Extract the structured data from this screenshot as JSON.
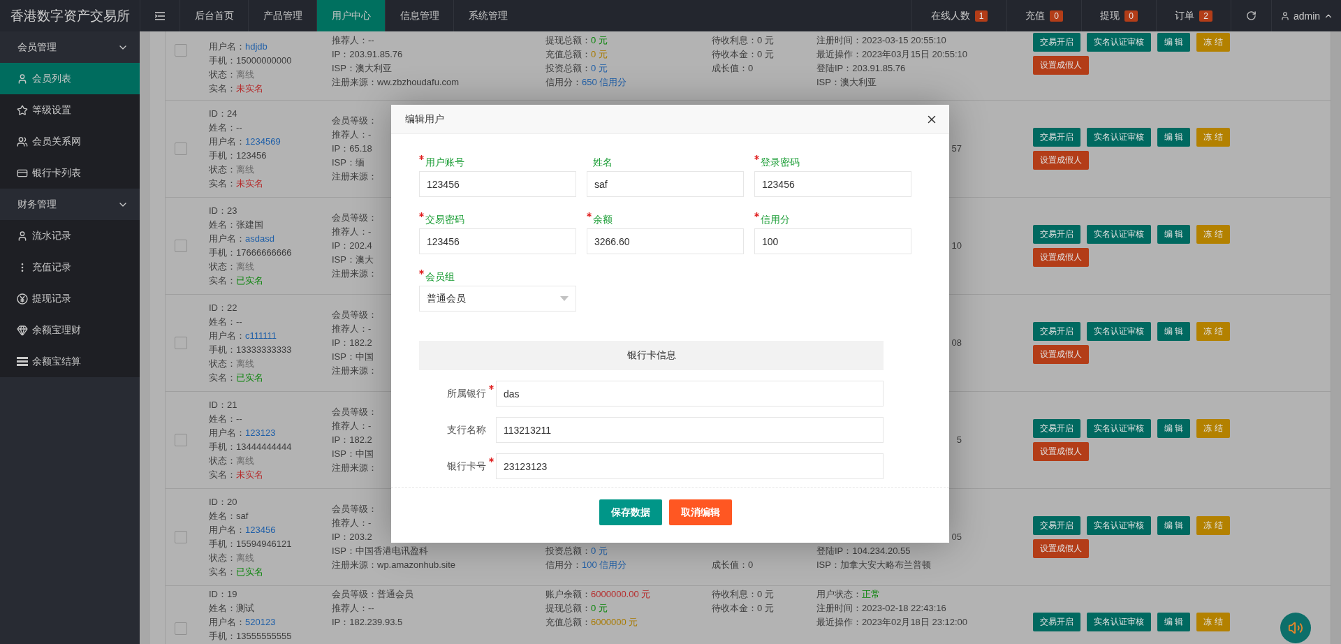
{
  "topbar": {
    "title": "香港数字资产交易所",
    "nav": [
      {
        "label": "后台首页",
        "selected": false
      },
      {
        "label": "产品管理",
        "selected": false
      },
      {
        "label": "用户中心",
        "selected": true
      },
      {
        "label": "信息管理",
        "selected": false
      },
      {
        "label": "系统管理",
        "selected": false
      }
    ],
    "stats": [
      {
        "label": "在线人数",
        "count": "1"
      },
      {
        "label": "充值",
        "count": "0"
      },
      {
        "label": "提现",
        "count": "0"
      },
      {
        "label": "订单",
        "count": "2"
      }
    ],
    "user": "admin"
  },
  "sidebar": {
    "groups": [
      {
        "label": "会员管理",
        "expanded": true,
        "items": [
          {
            "label": "会员列表",
            "selected": true
          },
          {
            "label": "等级设置",
            "selected": false
          },
          {
            "label": "会员关系网",
            "selected": false
          },
          {
            "label": "银行卡列表",
            "selected": false
          }
        ]
      },
      {
        "label": "财务管理",
        "expanded": true,
        "items": [
          {
            "label": "流水记录",
            "selected": false
          },
          {
            "label": "充值记录",
            "selected": false
          },
          {
            "label": "提现记录",
            "selected": false
          },
          {
            "label": "余额宝理财",
            "selected": false
          },
          {
            "label": "余额宝结算",
            "selected": false
          }
        ]
      }
    ]
  },
  "table": {
    "rows": [
      {
        "checked": false,
        "kind": "top",
        "cells": {
          "column_1": [
            {
              "label": "用户名：",
              "value": "hdjdb",
              "kind": "link"
            },
            {
              "label": "手机：",
              "value": "15000000000"
            },
            {
              "label": "状态：",
              "value": "离线",
              "color": "#6a6a6a"
            },
            {
              "label": "实名：",
              "value": "未实名",
              "color": "#b52a2a"
            }
          ],
          "column_2": [
            {
              "text": "推荐人：--"
            },
            {
              "label": "IP：",
              "value": "203.91.85.76"
            },
            {
              "label": "ISP：",
              "value": "澳大利亚"
            },
            {
              "label": "注册来源：",
              "value": "ww.zbzhoudafu.com"
            }
          ],
          "column_3": [
            {
              "label": "提现总额：",
              "value": "0 元",
              "color": "#0a840a"
            },
            {
              "label": "充值总额：",
              "value": "0 元",
              "color": "#a87a00"
            },
            {
              "label": "投资总额：",
              "value": "0 元",
              "color": "#1f5fa8"
            },
            {
              "label": "信用分：",
              "value": "650 信用分",
              "color": "#1f5fa8"
            }
          ],
          "column_4": [
            {
              "label": "待收利息：",
              "value": "0 元"
            },
            {
              "label": "待收本金：",
              "value": "0 元"
            },
            {
              "label": "成长值：",
              "value": "0"
            }
          ],
          "column_5": [
            {
              "label": "注册时间：",
              "value": "2023-03-15 20:55:10"
            },
            {
              "label": "最近操作：",
              "value": "2023年03月15日 20:55:10"
            },
            {
              "label": "登陆IP：",
              "value": "203.91.85.76"
            },
            {
              "label": "ISP：",
              "value": "澳大利亚"
            }
          ]
        },
        "actions": [
          {
            "label": "交易开启",
            "kind": "primary"
          },
          {
            "label": "实名认证审核",
            "kind": "primary"
          },
          {
            "label": "编 辑",
            "kind": "primary"
          },
          {
            "label": "冻 结",
            "kind": "warm"
          },
          {
            "label": "设置成假人",
            "kind": "danger"
          }
        ]
      },
      {
        "checked": false,
        "kind": "middle",
        "cells": {
          "column_1": [
            {
              "label": "ID：",
              "value": "24"
            },
            {
              "text": "姓名：--"
            },
            {
              "label": "用户名：",
              "value": "1234569",
              "kind": "link"
            },
            {
              "label": "手机：",
              "value": "123456"
            },
            {
              "label": "状态：",
              "value": "离线",
              "color": "#6a6a6a"
            },
            {
              "label": "实名：",
              "value": "未实名",
              "color": "#b52a2a"
            }
          ],
          "column_2": [
            {
              "label": "会员等级："
            },
            {
              "text": "推荐人：-"
            },
            {
              "label": "IP：",
              "value": "65.18"
            },
            {
              "label": "ISP：",
              "value": "缅"
            },
            {
              "label": "注册来源："
            }
          ],
          "column_5": [
            {
              "value": "57",
              "kind": "tail"
            }
          ]
        },
        "actions": [
          {
            "label": "交易开启",
            "kind": "primary"
          },
          {
            "label": "实名认证审核",
            "kind": "primary"
          },
          {
            "label": "编 辑",
            "kind": "primary"
          },
          {
            "label": "冻 结",
            "kind": "warm"
          },
          {
            "label": "设置成假人",
            "kind": "danger"
          }
        ]
      },
      {
        "checked": false,
        "kind": "middle",
        "cells": {
          "column_1": [
            {
              "label": "ID：",
              "value": "23"
            },
            {
              "label": "姓名：",
              "value": "张建国"
            },
            {
              "label": "用户名：",
              "value": "asdasd",
              "kind": "link"
            },
            {
              "label": "手机：",
              "value": "17666666666"
            },
            {
              "label": "状态：",
              "value": "离线",
              "color": "#6a6a6a"
            },
            {
              "label": "实名：",
              "value": "已实名",
              "color": "#0a840a"
            }
          ],
          "column_2": [
            {
              "label": "会员等级："
            },
            {
              "text": "推荐人：-"
            },
            {
              "label": "IP：",
              "value": "202.4"
            },
            {
              "label": "ISP：",
              "value": "澳大"
            },
            {
              "label": "注册来源："
            }
          ],
          "column_5": [
            {
              "value": "10",
              "kind": "tail"
            }
          ]
        },
        "actions": [
          {
            "label": "交易开启",
            "kind": "primary"
          },
          {
            "label": "实名认证审核",
            "kind": "primary"
          },
          {
            "label": "编 辑",
            "kind": "primary"
          },
          {
            "label": "冻 结",
            "kind": "warm"
          },
          {
            "label": "设置成假人",
            "kind": "danger"
          }
        ]
      },
      {
        "checked": false,
        "kind": "middle",
        "cells": {
          "column_1": [
            {
              "label": "ID：",
              "value": "22"
            },
            {
              "text": "姓名：--"
            },
            {
              "label": "用户名：",
              "value": "c111111",
              "kind": "link"
            },
            {
              "label": "手机：",
              "value": "13333333333"
            },
            {
              "label": "状态：",
              "value": "离线",
              "color": "#6a6a6a"
            },
            {
              "label": "实名：",
              "value": "已实名",
              "color": "#0a840a"
            }
          ],
          "column_2": [
            {
              "label": "会员等级："
            },
            {
              "text": "推荐人：-"
            },
            {
              "label": "IP：",
              "value": "182.2"
            },
            {
              "label": "ISP：",
              "value": "中国"
            },
            {
              "label": "注册来源："
            }
          ],
          "column_5": [
            {
              "value": "08",
              "kind": "tail"
            }
          ]
        },
        "actions": [
          {
            "label": "交易开启",
            "kind": "primary"
          },
          {
            "label": "实名认证审核",
            "kind": "primary"
          },
          {
            "label": "编 辑",
            "kind": "primary"
          },
          {
            "label": "冻 结",
            "kind": "warm"
          },
          {
            "label": "设置成假人",
            "kind": "danger"
          }
        ]
      },
      {
        "checked": false,
        "kind": "middle",
        "cells": {
          "column_1": [
            {
              "label": "ID：",
              "value": "21"
            },
            {
              "text": "姓名：--"
            },
            {
              "label": "用户名：",
              "value": "123123",
              "kind": "link"
            },
            {
              "label": "手机：",
              "value": "13444444444"
            },
            {
              "label": "状态：",
              "value": "离线",
              "color": "#6a6a6a"
            },
            {
              "label": "实名：",
              "value": "未实名",
              "color": "#b52a2a"
            }
          ],
          "column_2": [
            {
              "label": "会员等级："
            },
            {
              "text": "推荐人：-"
            },
            {
              "label": "IP：",
              "value": "182.2"
            },
            {
              "label": "ISP：",
              "value": "中国"
            },
            {
              "label": "注册来源："
            }
          ],
          "column_5": [
            {
              "value": "5",
              "kind": "tail"
            }
          ]
        },
        "actions": [
          {
            "label": "交易开启",
            "kind": "primary"
          },
          {
            "label": "实名认证审核",
            "kind": "primary"
          },
          {
            "label": "编 辑",
            "kind": "primary"
          },
          {
            "label": "冻 结",
            "kind": "warm"
          },
          {
            "label": "设置成假人",
            "kind": "danger"
          }
        ]
      },
      {
        "checked": false,
        "kind": "lower",
        "cells": {
          "column_1": [
            {
              "label": "ID：",
              "value": "20"
            },
            {
              "label": "姓名：",
              "value": "saf"
            },
            {
              "label": "用户名：",
              "value": "123456",
              "kind": "link"
            },
            {
              "label": "手机：",
              "value": "15594946121"
            },
            {
              "label": "状态：",
              "value": "离线",
              "color": "#6a6a6a"
            },
            {
              "label": "实名：",
              "value": "已实名",
              "color": "#0a840a"
            }
          ],
          "column_2": [
            {
              "label": "会员等级："
            },
            {
              "text": "推荐人：-"
            },
            {
              "label": "IP：",
              "value": "203.2"
            },
            {
              "label": "ISP：",
              "value": "中国香港电讯盈科"
            },
            {
              "label": "注册来源：",
              "value": "wp.amazonhub.site"
            }
          ],
          "column_3": [
            {
              "label": "投资总额：",
              "value": "0 元",
              "color": "#1f5fa8"
            },
            {
              "label": "信用分：",
              "value": "100 信用分",
              "color": "#1f5fa8"
            }
          ],
          "column_4": [
            {
              "label": "成长值：",
              "value": "0"
            }
          ],
          "column_5": [
            {
              "value": "05",
              "kind": "tail"
            },
            {
              "label": "登陆IP：",
              "value": "104.234.20.55"
            },
            {
              "label": "ISP：",
              "value": "加拿大安大略布兰普顿"
            }
          ]
        },
        "actions": [
          {
            "label": "交易开启",
            "kind": "primary"
          },
          {
            "label": "实名认证审核",
            "kind": "primary"
          },
          {
            "label": "编 辑",
            "kind": "primary"
          },
          {
            "label": "冻 结",
            "kind": "warm"
          },
          {
            "label": "设置成假人",
            "kind": "danger"
          }
        ]
      },
      {
        "checked": false,
        "kind": "bottom",
        "cells": {
          "column_1": [
            {
              "label": "ID：",
              "value": "19"
            },
            {
              "label": "姓名：",
              "value": "测试"
            },
            {
              "label": "用户名：",
              "value": "520123",
              "kind": "link"
            },
            {
              "label": "手机：",
              "value": "13555555555"
            }
          ],
          "column_2": [
            {
              "label": "会员等级：",
              "value": "普通会员"
            },
            {
              "text": "推荐人：--"
            },
            {
              "label": "IP：",
              "value": "182.239.93.5"
            }
          ],
          "column_3": [
            {
              "label": "账户余额：",
              "value": "6000000.00 元",
              "color": "#b52a2a"
            },
            {
              "label": "提现总额：",
              "value": "0 元",
              "color": "#0a840a"
            },
            {
              "label": "充值总额：",
              "value": "6000000 元",
              "color": "#a87a00"
            }
          ],
          "column_4": [
            {
              "label": "待收利息：",
              "value": "0 元"
            },
            {
              "label": "待收本金：",
              "value": "0 元"
            }
          ],
          "column_5": [
            {
              "label": "用户状态：",
              "value": "正常",
              "color": "#0a840a"
            },
            {
              "label": "注册时间：",
              "value": "2023-02-18 22:43:16"
            },
            {
              "label": "最近操作：",
              "value": "2023年02月18日 23:12:00"
            }
          ]
        },
        "actions": [
          {
            "label": "交易开启",
            "kind": "primary"
          },
          {
            "label": "实名认证审核",
            "kind": "primary"
          },
          {
            "label": "编 辑",
            "kind": "primary"
          },
          {
            "label": "冻 结",
            "kind": "warm"
          }
        ]
      }
    ]
  },
  "modal": {
    "title": "编辑用户",
    "fields": [
      {
        "label": "用户账号",
        "required": true,
        "value": "123456",
        "kind": "input"
      },
      {
        "label": "姓名",
        "required": false,
        "value": "saf",
        "kind": "input"
      },
      {
        "label": "登录密码",
        "required": true,
        "value": "123456",
        "kind": "input"
      },
      {
        "label": "交易密码",
        "required": true,
        "value": "123456",
        "kind": "input"
      },
      {
        "label": "余额",
        "required": true,
        "value": "3266.60",
        "kind": "input"
      },
      {
        "label": "信用分",
        "required": true,
        "value": "100",
        "kind": "input"
      },
      {
        "label": "会员组",
        "required": true,
        "value": "普通会员",
        "kind": "select"
      }
    ],
    "section": "银行卡信息",
    "bank_fields": [
      {
        "label": "所属银行",
        "required": true,
        "value": "das"
      },
      {
        "label": "支行名称",
        "required": false,
        "value": "113213211"
      },
      {
        "label": "银行卡号",
        "required": true,
        "value": "23123123"
      }
    ],
    "buttons": [
      {
        "label": "保存数据",
        "kind": "primary"
      },
      {
        "label": "取消编辑",
        "kind": "danger"
      }
    ]
  }
}
